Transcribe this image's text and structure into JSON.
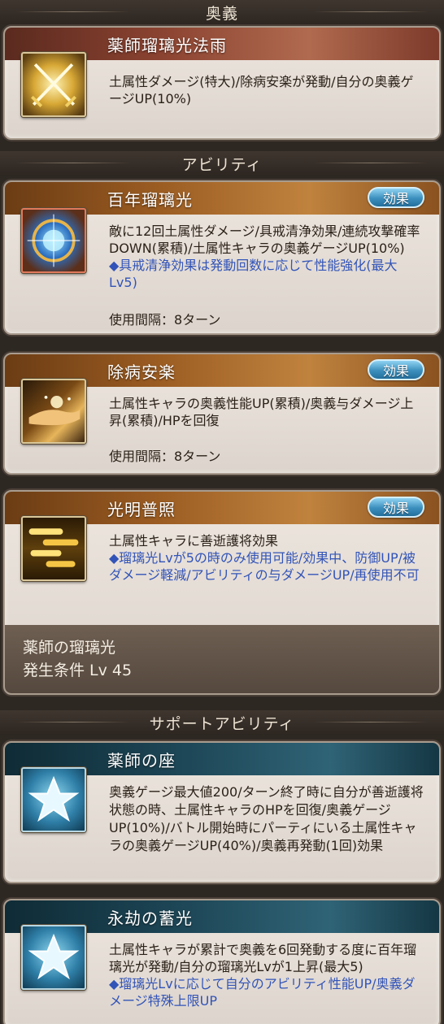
{
  "sections": {
    "ougi": "奥義",
    "ability": "アビリティ",
    "support": "サポートアビリティ"
  },
  "ougi": {
    "name": "薬師瑠璃光法雨",
    "icon": "crossed-swords-icon",
    "desc": "土属性ダメージ(特大)/除病安楽が発動/自分の奥義ゲージUP(10%)"
  },
  "abilities": [
    {
      "name": "百年瑠璃光",
      "icon": "orb-icon",
      "effect_label": "効果",
      "desc": "敵に12回土属性ダメージ/具戒清浄効果/連続攻撃確率DOWN(累積)/土属性キャラの奥義ゲージUP(10%)",
      "desc_blue": "◆具戒清浄効果は発動回数に応じて性能強化(最大Lv5)",
      "cooldown": "使用間隔：8ターン"
    },
    {
      "name": "除病安楽",
      "icon": "hand-icon",
      "effect_label": "効果",
      "desc": "土属性キャラの奥義性能UP(累積)/奥義与ダメージ上昇(累積)/HPを回復",
      "cooldown": "使用間隔：8ターン"
    },
    {
      "name": "光明普照",
      "icon": "clouds-icon",
      "effect_label": "効果",
      "desc": "土属性キャラに善逝護将効果",
      "desc_blue": "◆瑠璃光Lvが5の時のみ使用可能/効果中、防御UP/被ダメージ軽減/アビリティの与ダメージUP/再使用不可",
      "unlock_title": "薬師の瑠璃光",
      "unlock_cond": "発生条件 Lv 45"
    }
  ],
  "supports": [
    {
      "name": "薬師の座",
      "icon": "star-icon",
      "desc": "奥義ゲージ最大値200/ターン終了時に自分が善逝護将状態の時、土属性キャラのHPを回復/奥義ゲージUP(10%)/バトル開始時にパーティにいる土属性キャラの奥義ゲージUP(40%)/奥義再発動(1回)効果"
    },
    {
      "name": "永劫の蓄光",
      "icon": "star-icon",
      "desc": "土属性キャラが累計で奥義を6回発動する度に百年瑠璃光が発動/自分の瑠璃光Lvが1上昇(最大5)",
      "desc_blue": "◆瑠璃光Lvに応じて自分のアビリティ性能UP/奥義ダメージ特殊上限UP"
    }
  ],
  "colors": {
    "card_bg": "#ede6df",
    "ougi_title": "#8a4230",
    "ability_title": "#9b5c22",
    "support_title": "#1d4656",
    "effect_button": "#3b8fbd",
    "highlight_text": "#3254b8"
  }
}
